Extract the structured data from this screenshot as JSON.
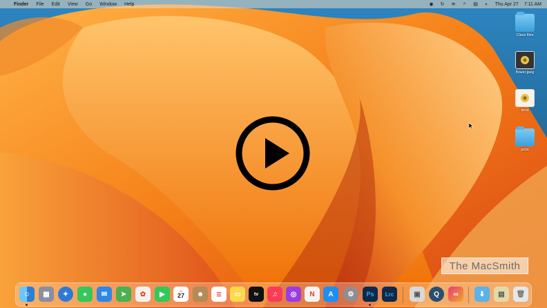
{
  "menubar": {
    "app_name": "Finder",
    "menus": [
      "File",
      "Edit",
      "View",
      "Go",
      "Window",
      "Help"
    ],
    "date": "Thu Apr 27",
    "time": "7:11 AM"
  },
  "desktop": {
    "items": [
      {
        "label": "Class files",
        "icon": "folder-icon"
      },
      {
        "label": "flower.jpeg",
        "icon": "image-icon"
      },
      {
        "label": "terst",
        "icon": "image-icon"
      },
      {
        "label": "picts",
        "icon": "folder-icon"
      }
    ]
  },
  "video": {
    "play_icon": "play-icon",
    "watermark": "The MacSmith"
  },
  "dock": {
    "calendar_day": "27",
    "apps": [
      {
        "name": "finder-icon",
        "color": "#3a8ee6"
      },
      {
        "name": "launchpad-icon",
        "color": "#8a8ea0"
      },
      {
        "name": "safari-icon",
        "color": "#2b7bd6"
      },
      {
        "name": "messages-icon",
        "color": "#35c759"
      },
      {
        "name": "mail-icon",
        "color": "#2f86e8"
      },
      {
        "name": "maps-icon",
        "color": "#4caf50"
      },
      {
        "name": "photos-icon",
        "color": "#f2f2f2"
      },
      {
        "name": "facetime-icon",
        "color": "#34c759"
      },
      {
        "name": "calendar-icon",
        "color": "#ffffff"
      },
      {
        "name": "contacts-icon",
        "color": "#b58a55"
      },
      {
        "name": "reminders-icon",
        "color": "#ffffff"
      },
      {
        "name": "notes-icon",
        "color": "#ffd94a"
      },
      {
        "name": "appletv-icon",
        "color": "#111111"
      },
      {
        "name": "music-icon",
        "color": "#fa3c56"
      },
      {
        "name": "podcasts-icon",
        "color": "#9b3ce0"
      },
      {
        "name": "news-icon",
        "color": "#f4f4f4"
      },
      {
        "name": "appstore-icon",
        "color": "#1f8ef1"
      },
      {
        "name": "system-settings-icon",
        "color": "#8e8e93"
      },
      {
        "name": "photoshop-icon",
        "color": "#0e2a4a"
      },
      {
        "name": "lightroom-classic-icon",
        "color": "#0e2a4a"
      },
      {
        "name": "preview-icon",
        "color": "#d8d8d8"
      },
      {
        "name": "quicktime-icon",
        "color": "#2a4f6e"
      },
      {
        "name": "creative-cloud-icon",
        "color": "#e63c7a"
      },
      {
        "name": "downloads-folder-icon",
        "color": "#5ab3e8"
      },
      {
        "name": "stack-icon",
        "color": "#e3d9a8"
      },
      {
        "name": "trash-icon",
        "color": "#e6e6e6"
      }
    ]
  },
  "colors": {
    "accent_orange": "#f27a1a",
    "sky_blue": "#1d5f8a"
  }
}
